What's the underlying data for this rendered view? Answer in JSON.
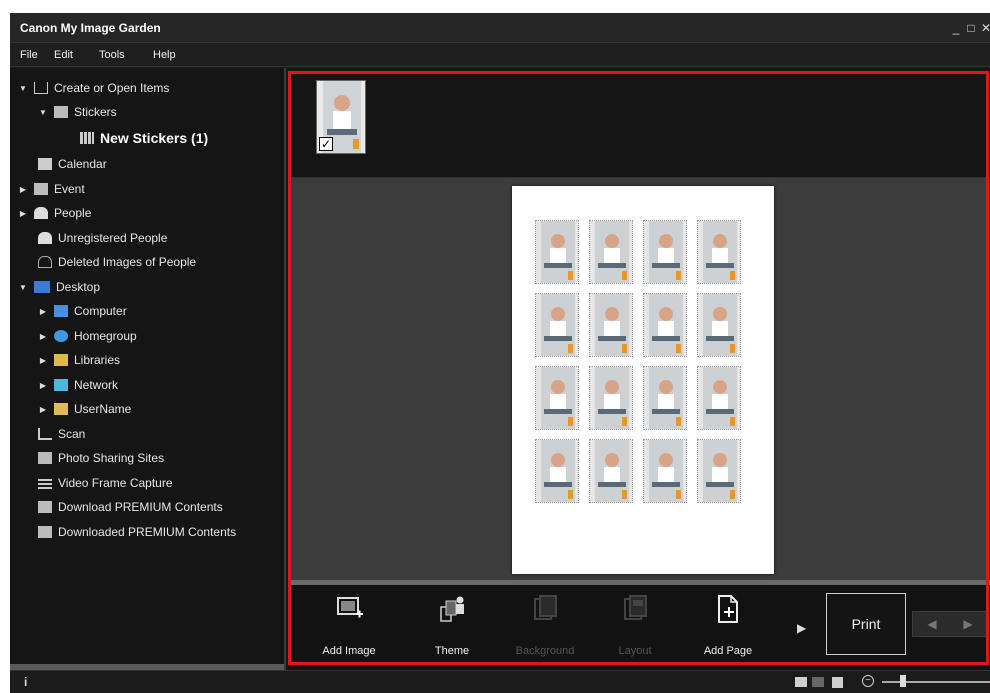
{
  "window": {
    "title": "Canon My Image Garden",
    "minimize": "_",
    "maximize": "□",
    "close": "✕"
  },
  "menu": [
    "File",
    "Edit",
    "Tools",
    "Help"
  ],
  "sidebar": {
    "items": [
      {
        "label": "Create or Open Items",
        "icon": "create-items-icon",
        "expanded": true
      },
      {
        "label": "Stickers",
        "icon": "stickers-icon",
        "expanded": true
      },
      {
        "label": "New Stickers (1)",
        "icon": "sticker-grid-icon"
      },
      {
        "label": "Calendar",
        "icon": "calendar-icon"
      },
      {
        "label": "Event",
        "icon": "event-icon"
      },
      {
        "label": "People",
        "icon": "people-icon"
      },
      {
        "label": "Unregistered People",
        "icon": "unregistered-people-icon"
      },
      {
        "label": "Deleted Images of People",
        "icon": "deleted-people-icon"
      },
      {
        "label": "Desktop",
        "icon": "desktop-icon",
        "expanded": true
      },
      {
        "label": "Computer",
        "icon": "computer-icon"
      },
      {
        "label": "Homegroup",
        "icon": "homegroup-icon"
      },
      {
        "label": "Libraries",
        "icon": "libraries-icon"
      },
      {
        "label": "Network",
        "icon": "network-icon"
      },
      {
        "label": "UserName",
        "icon": "user-folder-icon"
      },
      {
        "label": "Scan",
        "icon": "scan-icon"
      },
      {
        "label": "Photo Sharing Sites",
        "icon": "photo-sharing-icon"
      },
      {
        "label": "Video Frame Capture",
        "icon": "video-frame-icon"
      },
      {
        "label": "Download PREMIUM Contents",
        "icon": "download-premium-icon"
      },
      {
        "label": "Downloaded PREMIUM Contents",
        "icon": "downloaded-premium-icon"
      }
    ]
  },
  "toolbar": {
    "add_image": "Add Image",
    "theme": "Theme",
    "background": "Background",
    "layout": "Layout",
    "add_page": "Add Page",
    "print": "Print"
  },
  "colors": {
    "highlight_frame": "#e4141b",
    "background": "#1a1a1a"
  }
}
